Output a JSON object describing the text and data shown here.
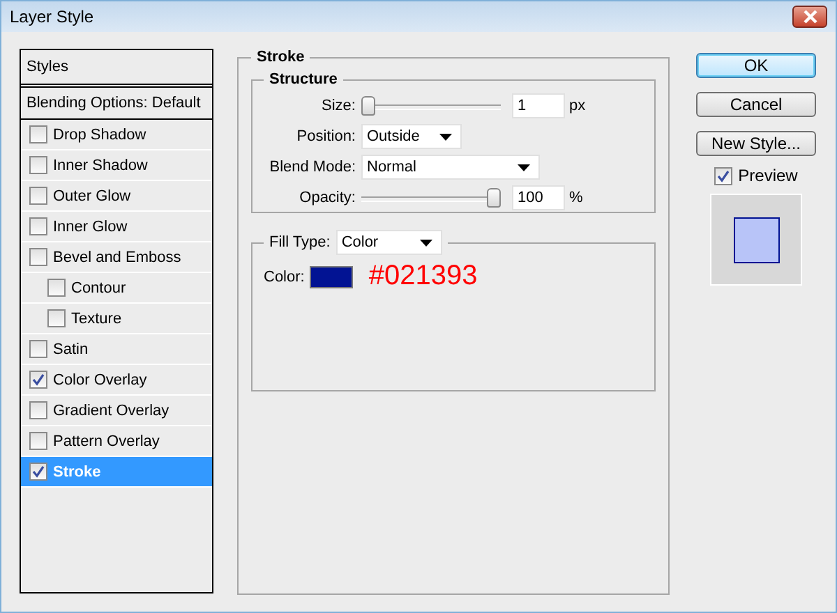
{
  "window": {
    "title": "Layer Style"
  },
  "styles_panel": {
    "header": "Styles",
    "items": [
      {
        "label": "Blending Options: Default",
        "kind": "plain",
        "selected": false
      },
      {
        "label": "Drop Shadow",
        "kind": "checkbox",
        "checked": false,
        "selected": false
      },
      {
        "label": "Inner Shadow",
        "kind": "checkbox",
        "checked": false,
        "selected": false
      },
      {
        "label": "Outer Glow",
        "kind": "checkbox",
        "checked": false,
        "selected": false
      },
      {
        "label": "Inner Glow",
        "kind": "checkbox",
        "checked": false,
        "selected": false
      },
      {
        "label": "Bevel and Emboss",
        "kind": "checkbox",
        "checked": false,
        "selected": false,
        "children": [
          {
            "label": "Contour",
            "kind": "checkbox",
            "checked": false,
            "selected": false
          },
          {
            "label": "Texture",
            "kind": "checkbox",
            "checked": false,
            "selected": false
          }
        ]
      },
      {
        "label": "Satin",
        "kind": "checkbox",
        "checked": false,
        "selected": false
      },
      {
        "label": "Color Overlay",
        "kind": "checkbox",
        "checked": true,
        "selected": false
      },
      {
        "label": "Gradient Overlay",
        "kind": "checkbox",
        "checked": false,
        "selected": false
      },
      {
        "label": "Pattern Overlay",
        "kind": "checkbox",
        "checked": false,
        "selected": false
      },
      {
        "label": "Stroke",
        "kind": "checkbox",
        "checked": true,
        "selected": true
      }
    ]
  },
  "stroke": {
    "title": "Stroke",
    "structure": {
      "title": "Structure",
      "size": {
        "label": "Size:",
        "level": 0,
        "value": "1",
        "unit": "px"
      },
      "position": {
        "label": "Position:",
        "value": "Outside"
      },
      "blend_mode": {
        "label": "Blend Mode:",
        "value": "Normal"
      },
      "opacity": {
        "label": "Opacity:",
        "level": 1,
        "value": "100",
        "unit": "%"
      }
    },
    "fill": {
      "label": "Fill Type:",
      "value": "Color",
      "color": {
        "label": "Color:",
        "color": "#021393",
        "note": "#021393"
      }
    }
  },
  "buttons": [
    {
      "label": "OK",
      "default": true
    },
    {
      "label": "Cancel",
      "default": false
    },
    {
      "label": "New Style...",
      "default": false
    }
  ],
  "preview": {
    "label": "Preview",
    "checked": true
  }
}
